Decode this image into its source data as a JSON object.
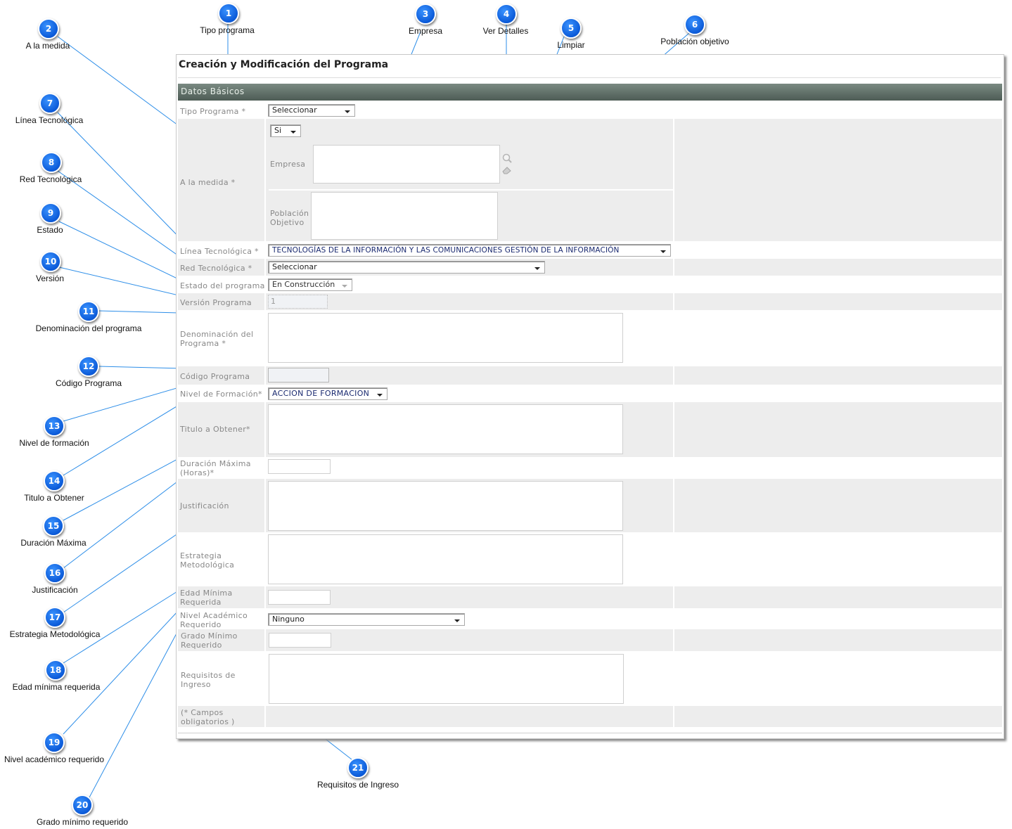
{
  "form": {
    "title": "Creación y Modificación del Programa",
    "section": "Datos Básicos",
    "tipo_programa": {
      "label": "Tipo Programa *",
      "value": "Seleccionar"
    },
    "a_la_medida": {
      "label": "A la medida *",
      "value": "Si"
    },
    "empresa": {
      "label": "Empresa"
    },
    "poblacion": {
      "label": "Población Objetivo"
    },
    "linea": {
      "label": "Línea Tecnológica *",
      "value": "TECNOLOGÍAS DE LA INFORMACIÓN Y LAS COMUNICACIONES GESTIÓN DE LA INFORMACIÓN"
    },
    "red": {
      "label": "Red Tecnológica *",
      "value": "Seleccionar"
    },
    "estado": {
      "label": "Estado del programa",
      "value": "En Construcción"
    },
    "version": {
      "label": "Versión Programa",
      "value": "1"
    },
    "denominacion": {
      "label": "Denominación del Programa *"
    },
    "codigo": {
      "label": "Código Programa"
    },
    "nivel_formacion": {
      "label": "Nivel de Formación*",
      "value": "ACCION DE FORMACION"
    },
    "titulo": {
      "label": "Titulo a Obtener*"
    },
    "duracion": {
      "label": "Duración Máxima (Horas)*"
    },
    "justificacion": {
      "label": "Justificación"
    },
    "estrategia": {
      "label": "Estrategia Metodológica"
    },
    "edad": {
      "label": "Edad Mínima Requerida"
    },
    "nivel_academico": {
      "label": "Nivel Académico Requerido",
      "value": "Ninguno"
    },
    "grado": {
      "label": "Grado Mínimo Requerido"
    },
    "requisitos": {
      "label": "Requisitos de Ingreso"
    },
    "note": "(* Campos obligatorios )"
  },
  "callouts": [
    {
      "n": "1",
      "text": "Tipo programa"
    },
    {
      "n": "2",
      "text": "A la medida"
    },
    {
      "n": "3",
      "text": "Empresa"
    },
    {
      "n": "4",
      "text": "Ver Detalles"
    },
    {
      "n": "5",
      "text": "Limpiar"
    },
    {
      "n": "6",
      "text": "Población objetivo"
    },
    {
      "n": "7",
      "text": "Línea Tecnológica"
    },
    {
      "n": "8",
      "text": "Red Tecnológica"
    },
    {
      "n": "9",
      "text": "Estado"
    },
    {
      "n": "10",
      "text": "Versión"
    },
    {
      "n": "11",
      "text": "Denominación del programa"
    },
    {
      "n": "12",
      "text": "Código Programa"
    },
    {
      "n": "13",
      "text": "Nivel de formación"
    },
    {
      "n": "14",
      "text": "Titulo a Obtener"
    },
    {
      "n": "15",
      "text": "Duración Máxima"
    },
    {
      "n": "16",
      "text": "Justificación"
    },
    {
      "n": "17",
      "text": "Estrategia Metodológica"
    },
    {
      "n": "18",
      "text": "Edad mínima requerida"
    },
    {
      "n": "19",
      "text": "Nivel académico requerido"
    },
    {
      "n": "20",
      "text": "Grado mínimo requerido"
    },
    {
      "n": "21",
      "text": "Requisitos de Ingreso"
    }
  ],
  "colors": {
    "callout": "#0b5ad8",
    "leader_line": "#2d8ee8",
    "section_bar": "#4d5c55",
    "row_alt": "#ededed"
  },
  "icons": {
    "details": "magnifier-icon",
    "clear": "eraser-icon"
  }
}
